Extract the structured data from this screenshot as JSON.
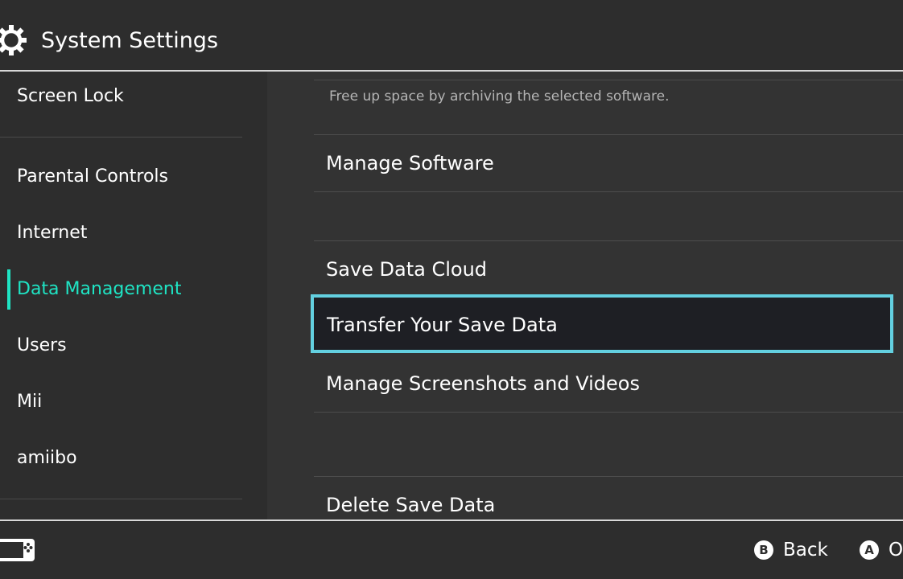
{
  "header": {
    "title": "System Settings",
    "icon": "gear-icon"
  },
  "sidebar": {
    "items": [
      {
        "label": "Screen Lock",
        "active": false
      },
      {
        "label": "Parental Controls",
        "active": false
      },
      {
        "label": "Internet",
        "active": false
      },
      {
        "label": "Data Management",
        "active": true
      },
      {
        "label": "Users",
        "active": false
      },
      {
        "label": "Mii",
        "active": false
      },
      {
        "label": "amiibo",
        "active": false
      }
    ],
    "active_color": "#1fe4c4"
  },
  "main": {
    "archive_description": "Free up space by archiving the selected software.",
    "items": [
      {
        "label": "Manage Software"
      },
      {
        "label": "Save Data Cloud"
      },
      {
        "label": "Transfer Your Save Data",
        "selected": true
      },
      {
        "label": "Manage Screenshots and Videos"
      },
      {
        "label": "Delete Save Data"
      }
    ],
    "selection_color": "#63d0e0"
  },
  "footer": {
    "controller_icon": "controller-icon",
    "back": {
      "button": "B",
      "label": "Back"
    },
    "ok": {
      "button": "A",
      "label": "O"
    }
  }
}
